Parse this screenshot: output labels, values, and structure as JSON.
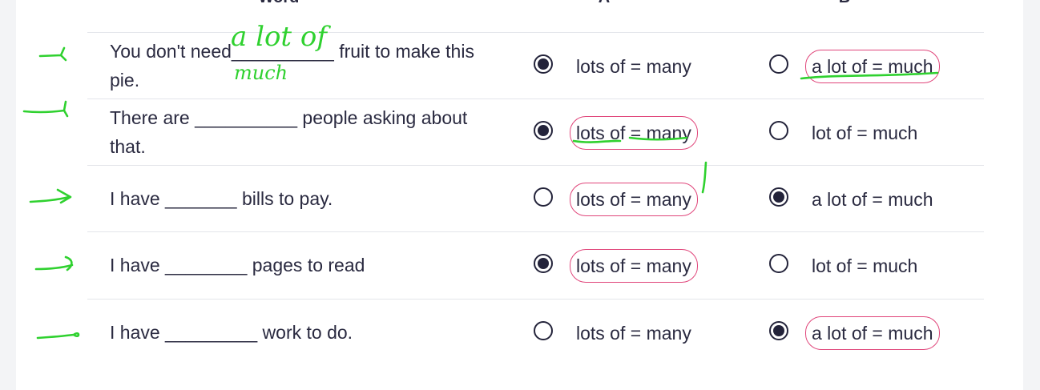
{
  "headers": {
    "word": "Word",
    "a": "A",
    "b": "B"
  },
  "rows": [
    {
      "question": "You don't need__________ fruit to make this pie.",
      "option_a": "lots of = many",
      "option_b": "a lot of = much",
      "selected": "A",
      "circled": [
        "B"
      ]
    },
    {
      "question": "There are __________ people asking about that.",
      "option_a": "lots of = many",
      "option_b": "lot of = much",
      "selected": "A",
      "circled": [
        "A"
      ]
    },
    {
      "question": "I have _______ bills to pay.",
      "option_a": "lots of = many",
      "option_b": "a lot of = much",
      "selected": "B",
      "circled": [
        "A"
      ]
    },
    {
      "question": "I have ________ pages to read",
      "option_a": "lots of = many",
      "option_b": "lot of = much",
      "selected": "A",
      "circled": [
        "A"
      ]
    },
    {
      "question": "I have _________ work to do.",
      "option_a": "lots of = many",
      "option_b": "a lot of = much",
      "selected": "B",
      "circled": [
        "B"
      ]
    }
  ],
  "handwriting": {
    "line1": "a lot of",
    "line2": "much"
  },
  "colors": {
    "text": "#2a2a40",
    "radio": "#23233a",
    "circle_annotation": "#e0457a",
    "pen_annotation": "#2fd12f",
    "divider": "#e3e5ea"
  }
}
